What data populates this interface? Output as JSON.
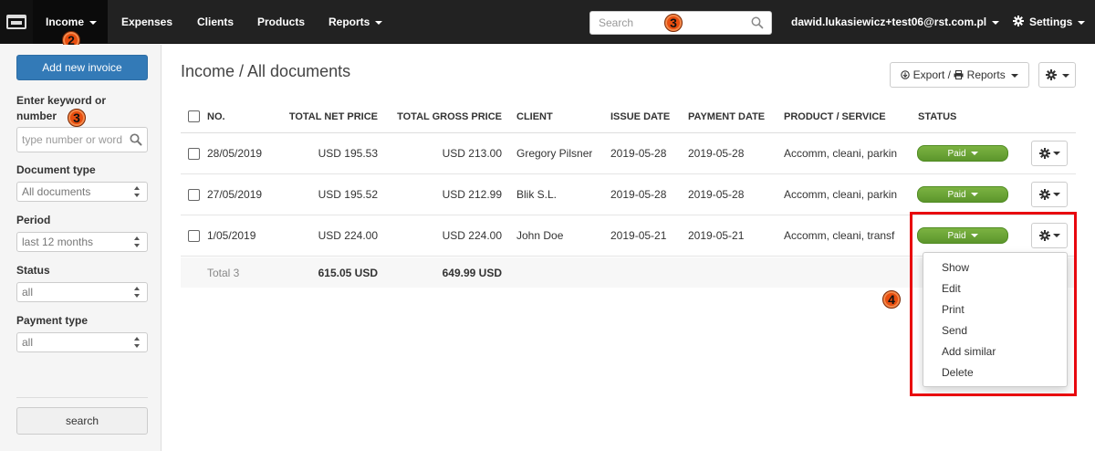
{
  "nav": {
    "items": [
      {
        "label": "Income",
        "dropdown": true,
        "active": true
      },
      {
        "label": "Expenses",
        "dropdown": false
      },
      {
        "label": "Clients",
        "dropdown": false
      },
      {
        "label": "Products",
        "dropdown": false
      },
      {
        "label": "Reports",
        "dropdown": true
      }
    ],
    "search_placeholder": "Search",
    "user": "dawid.lukasiewicz+test06@rst.com.pl",
    "settings": "Settings"
  },
  "markers": {
    "m2": "2",
    "m3a": "3",
    "m3b": "3",
    "m4": "4"
  },
  "sidebar": {
    "add_invoice": "Add new invoice",
    "keyword_label": "Enter keyword or number",
    "keyword_placeholder": "type number or word",
    "document_type_label": "Document type",
    "document_type_value": "All documents",
    "period_label": "Period",
    "period_value": "last 12 months",
    "status_label": "Status",
    "status_value": "all",
    "payment_type_label": "Payment type",
    "payment_type_value": "all",
    "search_button": "search"
  },
  "main": {
    "title": "Income / All documents",
    "export_label": "Export / ",
    "reports_label": "Reports"
  },
  "table": {
    "columns": [
      "NO.",
      "TOTAL NET PRICE",
      "TOTAL GROSS PRICE",
      "CLIENT",
      "ISSUE DATE",
      "PAYMENT DATE",
      "PRODUCT / SERVICE",
      "STATUS"
    ],
    "rows": [
      {
        "no": "28/05/2019",
        "net": "USD 195.53",
        "gross": "USD 213.00",
        "client": "Gregory Pilsner",
        "issue": "2019-05-28",
        "payment": "2019-05-28",
        "product": "Accomm, cleani, parkin",
        "status": "Paid"
      },
      {
        "no": "27/05/2019",
        "net": "USD 195.52",
        "gross": "USD 212.99",
        "client": "Blik S.L.",
        "issue": "2019-05-28",
        "payment": "2019-05-28",
        "product": "Accomm, cleani, parkin",
        "status": "Paid"
      },
      {
        "no": "1/05/2019",
        "net": "USD 224.00",
        "gross": "USD 224.00",
        "client": "John Doe",
        "issue": "2019-05-21",
        "payment": "2019-05-21",
        "product": "Accomm, cleani, transf",
        "status": "Paid"
      }
    ],
    "total": {
      "label": "Total 3",
      "net": "615.05 USD",
      "gross": "649.99 USD"
    }
  },
  "row_menu": {
    "items": [
      "Show",
      "Edit",
      "Print",
      "Send",
      "Add similar",
      "Delete"
    ]
  },
  "colors": {
    "navbar": "#222222",
    "primary": "#337ab7",
    "paid": "#5c962c",
    "highlight": "#e8070e",
    "marker": "#e84e0f"
  }
}
